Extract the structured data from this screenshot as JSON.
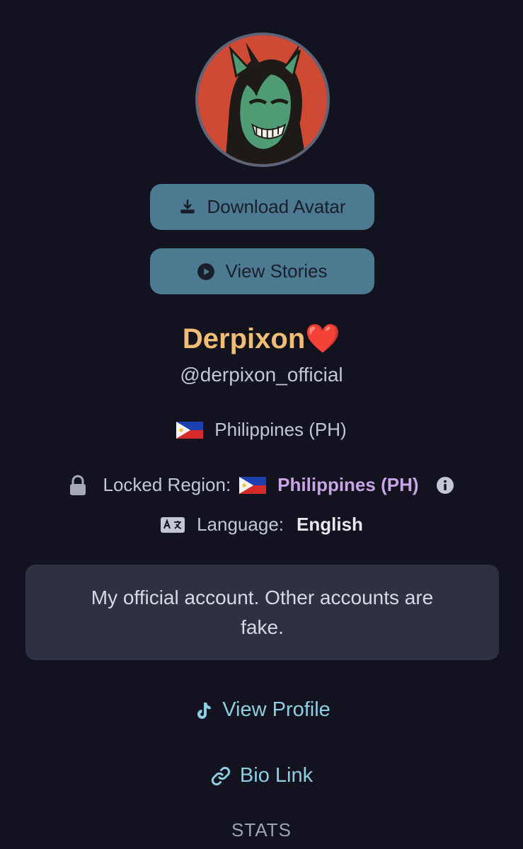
{
  "avatar": {
    "name": "Derpixon avatar"
  },
  "buttons": {
    "download_avatar": "Download Avatar",
    "view_stories": "View Stories"
  },
  "profile": {
    "display_name": "Derpixon❤️",
    "handle": "@derpixon_official",
    "country": "Philippines (PH)",
    "locked_region_label": "Locked Region:",
    "locked_region_value": "Philippines (PH)",
    "language_label": "Language:",
    "language_value": "English",
    "bio": "My official account. Other accounts are fake."
  },
  "links": {
    "view_profile": "View Profile",
    "bio_link": "Bio Link"
  },
  "section": {
    "stats": "STATS"
  },
  "colors": {
    "background": "#12131f",
    "button": "#4c7b91",
    "name": "#efbd74",
    "region_accent": "#c9a4e6",
    "link": "#8ccfe3",
    "bio_box": "#2f3142"
  },
  "icons": {
    "download": "download-icon",
    "play": "play-circle-icon",
    "lock": "lock-icon",
    "info": "info-icon",
    "language": "language-icon",
    "tiktok": "tiktok-icon",
    "link": "link-icon"
  }
}
